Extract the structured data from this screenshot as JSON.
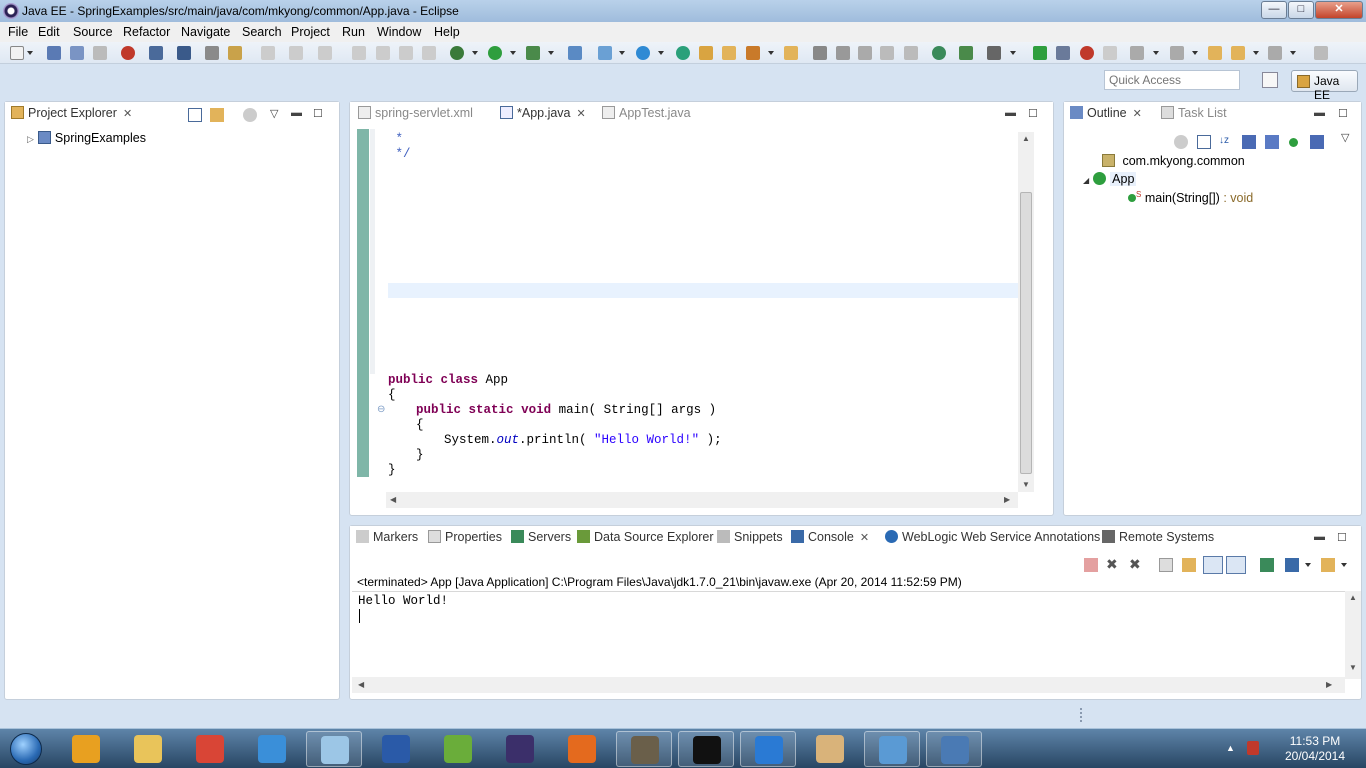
{
  "window": {
    "title": "Java EE - SpringExamples/src/main/java/com/mkyong/common/App.java - Eclipse",
    "min": "—",
    "max": "□",
    "close": "✕"
  },
  "menu": [
    "File",
    "Edit",
    "Source",
    "Refactor",
    "Navigate",
    "Search",
    "Project",
    "Run",
    "Window",
    "Help"
  ],
  "quick_access": {
    "placeholder": "Quick Access"
  },
  "perspective": {
    "label": "Java EE"
  },
  "project_explorer": {
    "tab": "Project Explorer",
    "items": [
      {
        "label": "SpringExamples"
      }
    ]
  },
  "editor": {
    "tabs": [
      {
        "label": "spring-servlet.xml"
      },
      {
        "label": "*App.java"
      },
      {
        "label": "AppTest.java"
      }
    ],
    "code": {
      "c1": " *",
      "c2": " */",
      "l1_kw1": "public",
      "l1_kw2": "class",
      "l1_rest": " App",
      "l2": "{",
      "l3_kw1": "public",
      "l3_kw2": "static",
      "l3_kw3": "void",
      "l3_rest": " main( String[] args )",
      "l4": "{",
      "l5_a": "System.",
      "l5_field": "out",
      "l5_b": ".println( ",
      "l5_str": "\"Hello World!\"",
      "l5_c": " );",
      "l6": "}",
      "l7": "}"
    }
  },
  "outline": {
    "tabs": [
      {
        "label": "Outline"
      },
      {
        "label": "Task List"
      }
    ],
    "package": "com.mkyong.common",
    "class": "App",
    "method": {
      "name": "main(String[])",
      "type": " : void",
      "modifier": "S"
    }
  },
  "console_panel": {
    "tabs": [
      {
        "label": "Markers"
      },
      {
        "label": "Properties"
      },
      {
        "label": "Servers"
      },
      {
        "label": "Data Source Explorer"
      },
      {
        "label": "Snippets"
      },
      {
        "label": "Console"
      },
      {
        "label": "WebLogic Web Service Annotations"
      },
      {
        "label": "Remote Systems"
      }
    ],
    "status": "<terminated> App [Java Application] C:\\Program Files\\Java\\jdk1.7.0_21\\bin\\javaw.exe (Apr 20, 2014 11:52:59 PM)",
    "output": "Hello World!"
  },
  "taskbar": {
    "apps": [
      {
        "name": "media-player",
        "color": "#e8a020"
      },
      {
        "name": "file-explorer",
        "color": "#e9c45a"
      },
      {
        "name": "chrome",
        "color": "#d94536"
      },
      {
        "name": "winamp",
        "color": "#3a8fd9"
      },
      {
        "name": "notepad",
        "color": "#9cc6e6"
      },
      {
        "name": "word",
        "color": "#2a5aa8"
      },
      {
        "name": "utorrent",
        "color": "#6aad3a"
      },
      {
        "name": "eclipse",
        "color": "#3b2f6a"
      },
      {
        "name": "firefox",
        "color": "#e46a1e"
      },
      {
        "name": "java-ee-ide",
        "color": "#6a5f4a"
      },
      {
        "name": "cmd",
        "color": "#111111"
      },
      {
        "name": "teamviewer",
        "color": "#2a7ad4"
      },
      {
        "name": "paint",
        "color": "#d9b37a"
      },
      {
        "name": "control-panel",
        "color": "#5a9ad4"
      },
      {
        "name": "remote-desktop",
        "color": "#4a7ab4"
      }
    ],
    "time": "11:53 PM",
    "date": "20/04/2014"
  },
  "colors": {
    "keyword": "#7f0055",
    "string": "#2a00ff",
    "field": "#0000c0",
    "comment": "#3f5fbf",
    "taskbar": "#3d5f83"
  }
}
